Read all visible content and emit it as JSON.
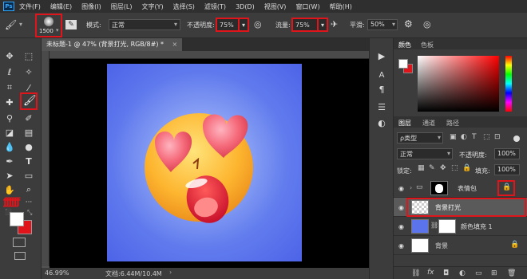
{
  "app": {
    "logo": "Ps"
  },
  "menu": [
    "文件(F)",
    "编辑(E)",
    "图像(I)",
    "图层(L)",
    "文字(Y)",
    "选择(S)",
    "滤镜(T)",
    "3D(D)",
    "视图(V)",
    "窗口(W)",
    "帮助(H)"
  ],
  "options": {
    "brush_size": "1500",
    "mode_label": "模式:",
    "mode_value": "正常",
    "opacity_label": "不透明度:",
    "opacity_value": "75%",
    "flow_label": "流量:",
    "flow_value": "75%",
    "smooth_label": "平滑:",
    "smooth_value": "50%"
  },
  "document": {
    "tab_title": "未标题-1 @ 47% (背景打光, RGB/8#) *",
    "zoom": "46.99%",
    "doc_size": "文档:6.44M/10.4M"
  },
  "color_panel": {
    "tab1": "颜色",
    "tab2": "色板"
  },
  "layers_panel": {
    "tab_layers": "图层",
    "tab_channels": "通道",
    "tab_paths": "路径",
    "filter_kind": "ρ类型",
    "blend_mode": "正常",
    "opacity_label": "不透明度:",
    "opacity_value": "100%",
    "lock_label": "锁定:",
    "fill_label": "填充:",
    "fill_value": "100%",
    "layers": [
      {
        "name": "表情包"
      },
      {
        "name": "背景打光"
      },
      {
        "name": "颜色填充 1"
      },
      {
        "name": "背景"
      }
    ]
  },
  "colors": {
    "accent_red": "#e0151b",
    "canvas_blue": "#5b74ec",
    "foreground": "#ffffff",
    "background": "#e0151b"
  }
}
